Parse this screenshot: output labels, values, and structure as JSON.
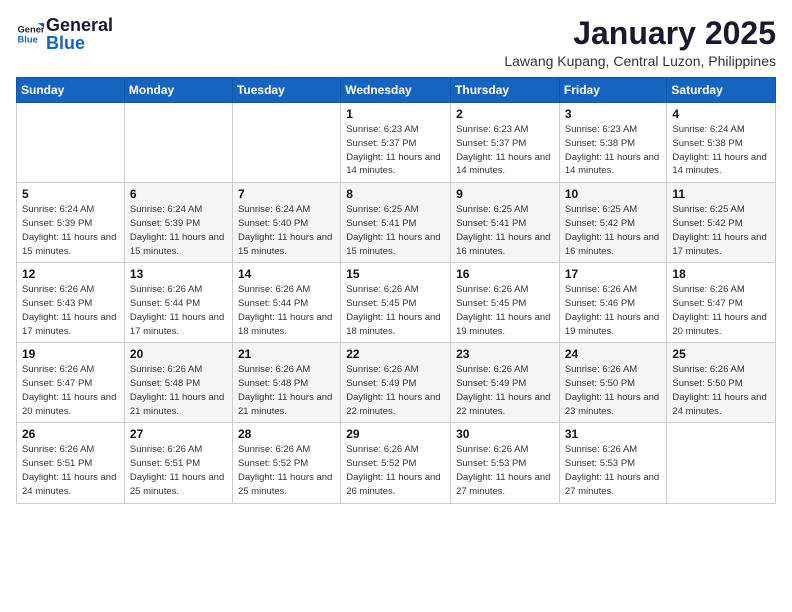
{
  "header": {
    "logo_general": "General",
    "logo_blue": "Blue",
    "month_title": "January 2025",
    "location": "Lawang Kupang, Central Luzon, Philippines"
  },
  "weekdays": [
    "Sunday",
    "Monday",
    "Tuesday",
    "Wednesday",
    "Thursday",
    "Friday",
    "Saturday"
  ],
  "weeks": [
    [
      null,
      null,
      null,
      {
        "day": 1,
        "sunrise": "6:23 AM",
        "sunset": "5:37 PM",
        "daylight": "11 hours and 14 minutes."
      },
      {
        "day": 2,
        "sunrise": "6:23 AM",
        "sunset": "5:37 PM",
        "daylight": "11 hours and 14 minutes."
      },
      {
        "day": 3,
        "sunrise": "6:23 AM",
        "sunset": "5:38 PM",
        "daylight": "11 hours and 14 minutes."
      },
      {
        "day": 4,
        "sunrise": "6:24 AM",
        "sunset": "5:38 PM",
        "daylight": "11 hours and 14 minutes."
      }
    ],
    [
      {
        "day": 5,
        "sunrise": "6:24 AM",
        "sunset": "5:39 PM",
        "daylight": "11 hours and 15 minutes."
      },
      {
        "day": 6,
        "sunrise": "6:24 AM",
        "sunset": "5:39 PM",
        "daylight": "11 hours and 15 minutes."
      },
      {
        "day": 7,
        "sunrise": "6:24 AM",
        "sunset": "5:40 PM",
        "daylight": "11 hours and 15 minutes."
      },
      {
        "day": 8,
        "sunrise": "6:25 AM",
        "sunset": "5:41 PM",
        "daylight": "11 hours and 15 minutes."
      },
      {
        "day": 9,
        "sunrise": "6:25 AM",
        "sunset": "5:41 PM",
        "daylight": "11 hours and 16 minutes."
      },
      {
        "day": 10,
        "sunrise": "6:25 AM",
        "sunset": "5:42 PM",
        "daylight": "11 hours and 16 minutes."
      },
      {
        "day": 11,
        "sunrise": "6:25 AM",
        "sunset": "5:42 PM",
        "daylight": "11 hours and 17 minutes."
      }
    ],
    [
      {
        "day": 12,
        "sunrise": "6:26 AM",
        "sunset": "5:43 PM",
        "daylight": "11 hours and 17 minutes."
      },
      {
        "day": 13,
        "sunrise": "6:26 AM",
        "sunset": "5:44 PM",
        "daylight": "11 hours and 17 minutes."
      },
      {
        "day": 14,
        "sunrise": "6:26 AM",
        "sunset": "5:44 PM",
        "daylight": "11 hours and 18 minutes."
      },
      {
        "day": 15,
        "sunrise": "6:26 AM",
        "sunset": "5:45 PM",
        "daylight": "11 hours and 18 minutes."
      },
      {
        "day": 16,
        "sunrise": "6:26 AM",
        "sunset": "5:45 PM",
        "daylight": "11 hours and 19 minutes."
      },
      {
        "day": 17,
        "sunrise": "6:26 AM",
        "sunset": "5:46 PM",
        "daylight": "11 hours and 19 minutes."
      },
      {
        "day": 18,
        "sunrise": "6:26 AM",
        "sunset": "5:47 PM",
        "daylight": "11 hours and 20 minutes."
      }
    ],
    [
      {
        "day": 19,
        "sunrise": "6:26 AM",
        "sunset": "5:47 PM",
        "daylight": "11 hours and 20 minutes."
      },
      {
        "day": 20,
        "sunrise": "6:26 AM",
        "sunset": "5:48 PM",
        "daylight": "11 hours and 21 minutes."
      },
      {
        "day": 21,
        "sunrise": "6:26 AM",
        "sunset": "5:48 PM",
        "daylight": "11 hours and 21 minutes."
      },
      {
        "day": 22,
        "sunrise": "6:26 AM",
        "sunset": "5:49 PM",
        "daylight": "11 hours and 22 minutes."
      },
      {
        "day": 23,
        "sunrise": "6:26 AM",
        "sunset": "5:49 PM",
        "daylight": "11 hours and 22 minutes."
      },
      {
        "day": 24,
        "sunrise": "6:26 AM",
        "sunset": "5:50 PM",
        "daylight": "11 hours and 23 minutes."
      },
      {
        "day": 25,
        "sunrise": "6:26 AM",
        "sunset": "5:50 PM",
        "daylight": "11 hours and 24 minutes."
      }
    ],
    [
      {
        "day": 26,
        "sunrise": "6:26 AM",
        "sunset": "5:51 PM",
        "daylight": "11 hours and 24 minutes."
      },
      {
        "day": 27,
        "sunrise": "6:26 AM",
        "sunset": "5:51 PM",
        "daylight": "11 hours and 25 minutes."
      },
      {
        "day": 28,
        "sunrise": "6:26 AM",
        "sunset": "5:52 PM",
        "daylight": "11 hours and 25 minutes."
      },
      {
        "day": 29,
        "sunrise": "6:26 AM",
        "sunset": "5:52 PM",
        "daylight": "11 hours and 26 minutes."
      },
      {
        "day": 30,
        "sunrise": "6:26 AM",
        "sunset": "5:53 PM",
        "daylight": "11 hours and 27 minutes."
      },
      {
        "day": 31,
        "sunrise": "6:26 AM",
        "sunset": "5:53 PM",
        "daylight": "11 hours and 27 minutes."
      },
      null
    ]
  ]
}
